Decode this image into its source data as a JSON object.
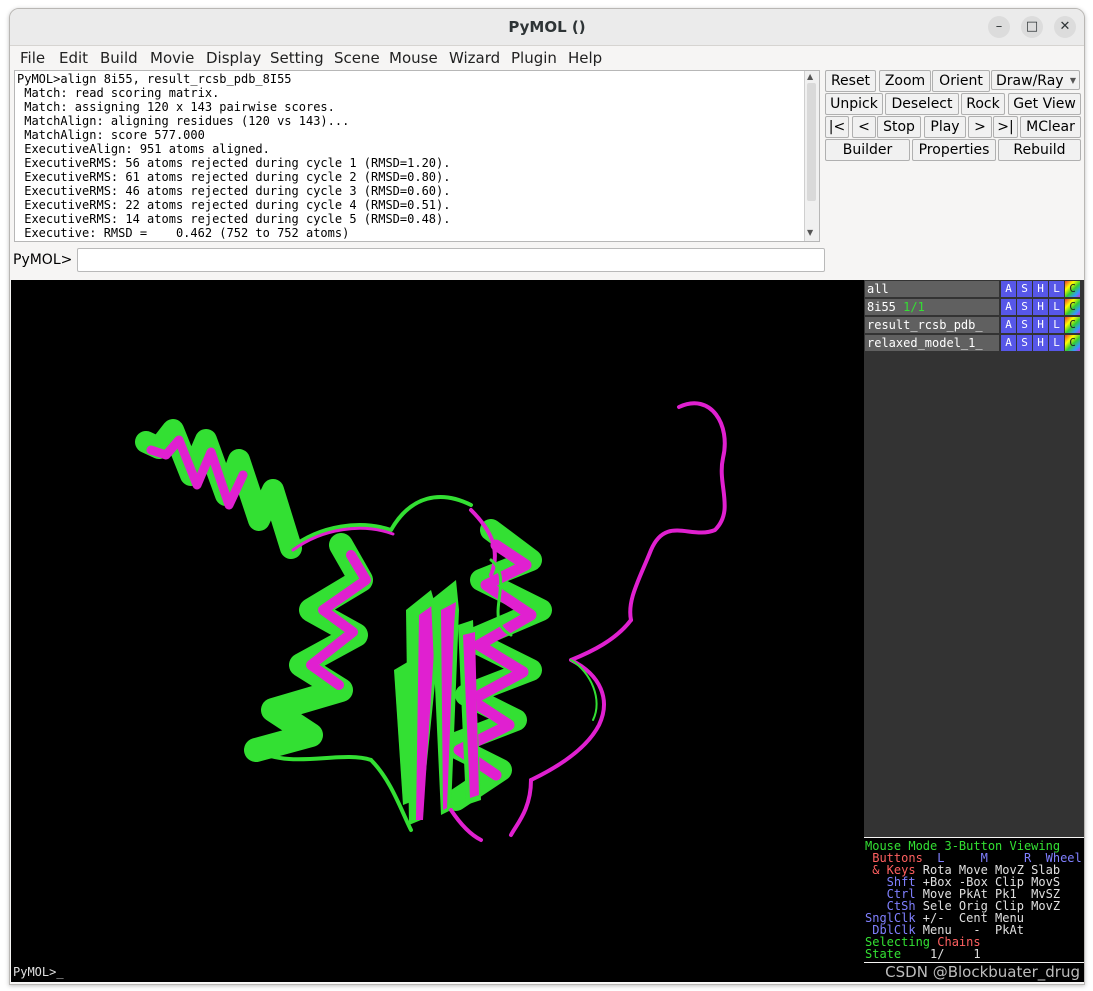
{
  "window": {
    "title": "PyMOL ()",
    "controls": [
      "–",
      "□",
      "✕"
    ]
  },
  "menu": [
    "File",
    "Edit",
    "Build",
    "Movie",
    "Display",
    "Setting",
    "Scene",
    "Mouse",
    "Wizard",
    "Plugin",
    "Help"
  ],
  "console": {
    "lines": [
      "PyMOL>align 8i55, result_rcsb_pdb_8I55",
      " Match: read scoring matrix.",
      " Match: assigning 120 x 143 pairwise scores.",
      " MatchAlign: aligning residues (120 vs 143)...",
      " MatchAlign: score 577.000",
      " ExecutiveAlign: 951 atoms aligned.",
      " ExecutiveRMS: 56 atoms rejected during cycle 1 (RMSD=1.20).",
      " ExecutiveRMS: 61 atoms rejected during cycle 2 (RMSD=0.80).",
      " ExecutiveRMS: 46 atoms rejected during cycle 3 (RMSD=0.60).",
      " ExecutiveRMS: 22 atoms rejected during cycle 4 (RMSD=0.51).",
      " ExecutiveRMS: 14 atoms rejected during cycle 5 (RMSD=0.48).",
      " Executive: RMSD =    0.462 (752 to 752 atoms)"
    ],
    "prompt_label": "PyMOL>",
    "input_value": ""
  },
  "buttons": {
    "reset": "Reset",
    "zoom": "Zoom",
    "orient": "Orient",
    "draw_ray": "Draw/Ray",
    "unpick": "Unpick",
    "deselect": "Deselect",
    "rock": "Rock",
    "get_view": "Get View",
    "first": "|<",
    "prev": "<",
    "stop": "Stop",
    "play": "Play",
    "next": ">",
    "last": ">|",
    "mclear": "MClear",
    "builder": "Builder",
    "properties": "Properties",
    "rebuild": "Rebuild"
  },
  "objects": [
    {
      "name": "all",
      "state": "",
      "buttons": [
        "A",
        "S",
        "H",
        "L",
        "C"
      ]
    },
    {
      "name": "8i55",
      "state": "1/1",
      "buttons": [
        "A",
        "S",
        "H",
        "L",
        "C"
      ]
    },
    {
      "name": "result_rcsb_pdb_",
      "state": "",
      "buttons": [
        "A",
        "S",
        "H",
        "L",
        "C"
      ]
    },
    {
      "name": "relaxed_model_1_",
      "state": "",
      "buttons": [
        "A",
        "S",
        "H",
        "L",
        "C"
      ]
    }
  ],
  "mouse_mode": {
    "title_a": "Mouse Mode ",
    "title_b": "3-Button Viewing",
    "row_buttons": {
      "label": " Buttons",
      "cols": "  L     M     R  ",
      "wheel": "Wheel"
    },
    "rows": [
      {
        "label": " & Keys",
        "text": " Rota Move MovZ Slab"
      },
      {
        "label": "   Shft",
        "text": " +Box -Box Clip MovS"
      },
      {
        "label": "   Ctrl",
        "text": " Move PkAt Pk1  MvSZ"
      },
      {
        "label": "   CtSh",
        "text": " Sele Orig Clip MovZ"
      },
      {
        "label": "SnglClk",
        "text": " +/-  Cent Menu"
      },
      {
        "label": " DblClk",
        "text": " Menu   -  PkAt"
      }
    ],
    "selecting_a": "Selecting ",
    "selecting_b": "Chains",
    "state_label": "State ",
    "state_value": "   1/    1"
  },
  "bottom_prompt": "PyMOL>_",
  "watermark": "CSDN @Blockbuater_drug",
  "colors": {
    "model_a": "#33e033",
    "model_b": "#e020d0",
    "button_blue": "#5757e8",
    "panel_bg": "#333333"
  }
}
